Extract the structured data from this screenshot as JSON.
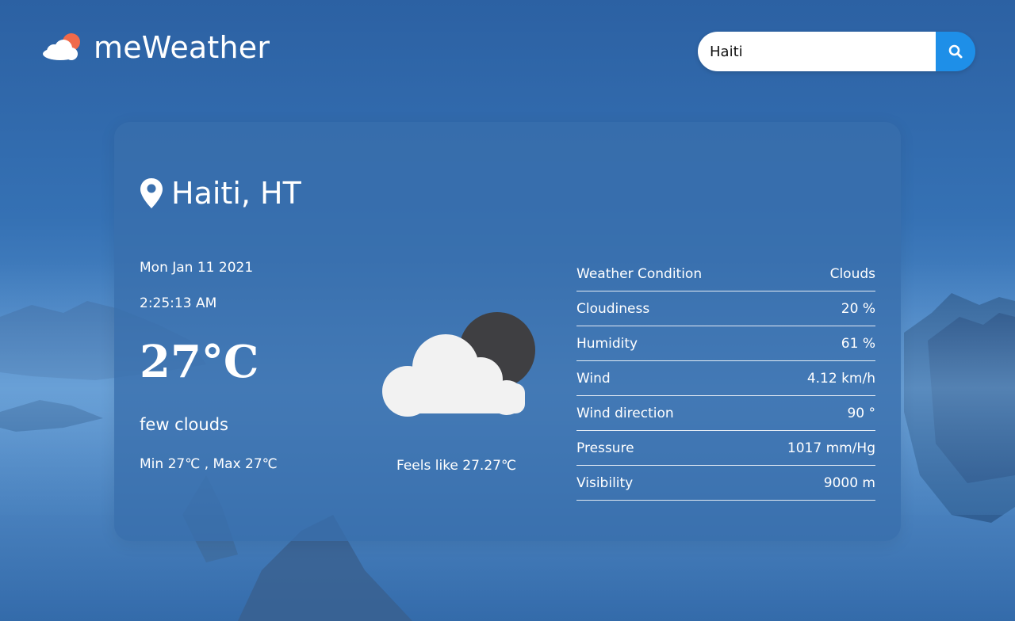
{
  "app": {
    "name": "meWeather"
  },
  "icons": {
    "logo": "cloud-sun-logo-icon",
    "search": "search-icon",
    "location": "map-pin-icon",
    "weather": "cloud-moon-icon"
  },
  "colors": {
    "search_button": "#1e8fe8",
    "logo_sun": "#f06a4a"
  },
  "search": {
    "value": "Haiti",
    "placeholder": ""
  },
  "location": {
    "name": "Haiti, HT"
  },
  "current": {
    "date": "Mon Jan 11 2021",
    "time": "2:25:13 AM",
    "temperature": "27°C",
    "description": "few clouds",
    "minmax": "Min 27℃ , Max 27℃",
    "feels_like": "Feels like 27.27℃"
  },
  "details": [
    {
      "label": "Weather Condition",
      "value": "Clouds"
    },
    {
      "label": "Cloudiness",
      "value": "20 %"
    },
    {
      "label": "Humidity",
      "value": "61 %"
    },
    {
      "label": "Wind",
      "value": "4.12 km/h"
    },
    {
      "label": "Wind direction",
      "value": "90 °"
    },
    {
      "label": "Pressure",
      "value": "1017 mm/Hg"
    },
    {
      "label": "Visibility",
      "value": "9000 m"
    }
  ]
}
